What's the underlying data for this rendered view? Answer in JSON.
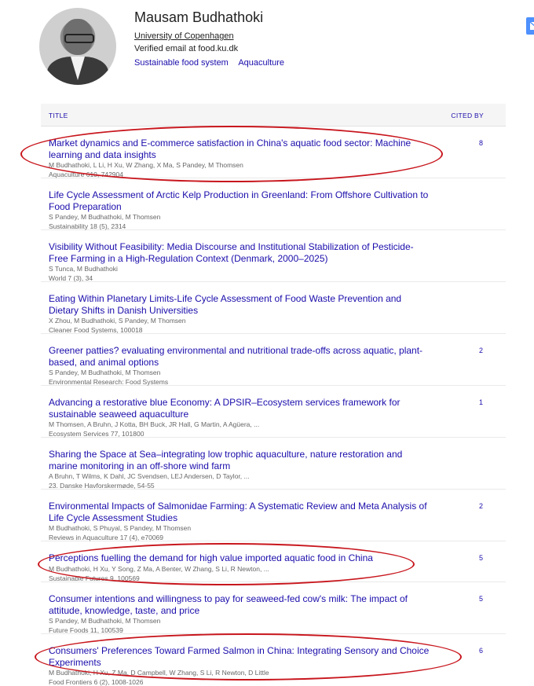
{
  "profile": {
    "name": "Mausam Budhathoki",
    "affiliation": "University of Copenhagen",
    "email": "Verified email at food.ku.dk",
    "interests": [
      "Sustainable food system",
      "Aquaculture"
    ]
  },
  "table": {
    "header_title": "TITLE",
    "header_cited": "CITED BY",
    "rows": [
      {
        "title": "Market dynamics and E-commerce satisfaction in China's aquatic food sector: Machine learning and data insights",
        "authors": "M Budhathoki, L Li, H Xu, W Zhang, X Ma, S Pandey, M Thomsen",
        "venue": "Aquaculture 610, 742904",
        "cited": "8"
      },
      {
        "title": "Life Cycle Assessment of Arctic Kelp Production in Greenland: From Offshore Cultivation to Food Preparation",
        "authors": "S Pandey, M Budhathoki, M Thomsen",
        "venue": "Sustainability 18 (5), 2314",
        "cited": ""
      },
      {
        "title": "Visibility Without Feasibility: Media Discourse and Institutional Stabilization of Pesticide-Free Farming in a High-Regulation Context (Denmark, 2000–2025)",
        "authors": "S Tunca, M Budhathoki",
        "venue": "World 7 (3), 34",
        "cited": ""
      },
      {
        "title": "Eating Within Planetary Limits-Life Cycle Assessment of Food Waste Prevention and Dietary Shifts in Danish Universities",
        "authors": "X Zhou, M Budhathoki, S Pandey, M Thomsen",
        "venue": "Cleaner Food Systems, 100018",
        "cited": ""
      },
      {
        "title": "Greener patties? evaluating environmental and nutritional trade-offs across aquatic, plant-based, and animal options",
        "authors": "S Pandey, M Budhathoki, M Thomsen",
        "venue": "Environmental Research: Food Systems",
        "cited": "2"
      },
      {
        "title": "Advancing a restorative blue Economy: A DPSIR–Ecosystem services framework for sustainable seaweed aquaculture",
        "authors": "M Thomsen, A Bruhn, J Kotta, BH Buck, JR Hall, G Martin, A Agüera, ...",
        "venue": "Ecosystem Services 77, 101800",
        "cited": "1"
      },
      {
        "title": "Sharing the Space at Sea–integrating low trophic aquaculture, nature restoration and marine monitoring in an off-shore wind farm",
        "authors": "A Bruhn, T Wilms, K Dahl, JC Svendsen, LEJ Andersen, D Taylor, ...",
        "venue": "23. Danske Havforskermøde, 54-55",
        "cited": ""
      },
      {
        "title": "Environmental Impacts of Salmonidae Farming: A Systematic Review and Meta Analysis of Life Cycle Assessment Studies",
        "authors": "M Budhathoki, S Phuyal, S Pandey, M Thomsen",
        "venue": "Reviews in Aquaculture 17 (4), e70069",
        "cited": "2"
      },
      {
        "title": "Perceptions fuelling the demand for high value imported aquatic food in China",
        "authors": "M Budhathoki, H Xu, Y Song, Z Ma, A Benter, W Zhang, S Li, R Newton, ...",
        "venue": "Sustainable Futures 9, 100569",
        "cited": "5"
      },
      {
        "title": "Consumer intentions and willingness to pay for seaweed-fed cow's milk: The impact of attitude, knowledge, taste, and price",
        "authors": "S Pandey, M Budhathoki, M Thomsen",
        "venue": "Future Foods 11, 100539",
        "cited": "5"
      },
      {
        "title": "Consumers' Preferences Toward Farmed Salmon in China: Integrating Sensory and Choice Experiments",
        "authors": "M Budhathoki, H Xu, Z Ma, D Campbell, W Zhang, S Li, R Newton, D Little",
        "venue": "Food Frontiers 6 (2), 1008-1026",
        "cited": "6"
      }
    ]
  },
  "colors": {
    "link": "#1a0dab",
    "annotation": "#c8161d",
    "follow_button": "#4d90fe"
  }
}
